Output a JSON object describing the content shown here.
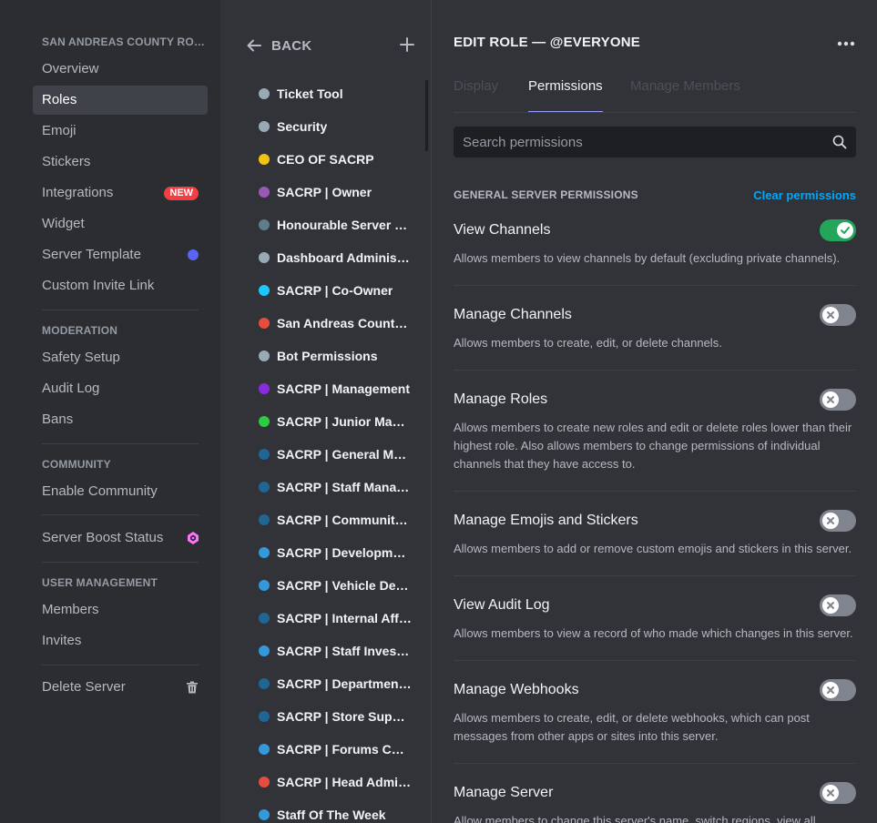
{
  "sidebar": {
    "server_name": "SAN ANDREAS COUNTY ROLEPLAY",
    "items_main": [
      {
        "label": "Overview"
      },
      {
        "label": "Roles"
      },
      {
        "label": "Emoji"
      },
      {
        "label": "Stickers"
      },
      {
        "label": "Integrations",
        "badge": "NEW"
      },
      {
        "label": "Widget"
      },
      {
        "label": "Server Template"
      },
      {
        "label": "Custom Invite Link"
      }
    ],
    "moderation_header": "MODERATION",
    "items_moderation": [
      {
        "label": "Safety Setup"
      },
      {
        "label": "Audit Log"
      },
      {
        "label": "Bans"
      }
    ],
    "community_header": "COMMUNITY",
    "enable_community": "Enable Community",
    "server_boost": "Server Boost Status",
    "user_management_header": "USER MANAGEMENT",
    "items_user_management": [
      {
        "label": "Members"
      },
      {
        "label": "Invites"
      }
    ],
    "delete_server": "Delete Server",
    "colors": {
      "new_badge": "#f23f43",
      "template_dot": "#5865f2",
      "boost": "#ff73fa"
    }
  },
  "roles_panel": {
    "back_label": "BACK",
    "roles": [
      {
        "name": "Ticket Tool",
        "color": "#99aab5"
      },
      {
        "name": "Security",
        "color": "#99aab5"
      },
      {
        "name": "CEO OF SACRP",
        "color": "#f1c40f"
      },
      {
        "name": "SACRP | Owner",
        "color": "#9b59b6"
      },
      {
        "name": "Honourable Server Owner",
        "color": "#607d8b"
      },
      {
        "name": "Dashboard Administrator",
        "color": "#99aab5"
      },
      {
        "name": "SACRP | Co-Owner",
        "color": "#1cc9ff"
      },
      {
        "name": "San Andreas County Roleplay",
        "color": "#e74c3c"
      },
      {
        "name": "Bot Permissions",
        "color": "#99aab5"
      },
      {
        "name": "SACRP | Management",
        "color": "#8a2be2"
      },
      {
        "name": "SACRP | Junior Management",
        "color": "#2ecc40"
      },
      {
        "name": "SACRP | General Manager",
        "color": "#206694"
      },
      {
        "name": "SACRP | Staff Manager",
        "color": "#206694"
      },
      {
        "name": "SACRP | Community Manager",
        "color": "#206694"
      },
      {
        "name": "SACRP | Development",
        "color": "#3498db"
      },
      {
        "name": "SACRP | Vehicle Developer",
        "color": "#3498db"
      },
      {
        "name": "SACRP | Internal Affairs",
        "color": "#206694"
      },
      {
        "name": "SACRP | Staff Investigator",
        "color": "#3498db"
      },
      {
        "name": "SACRP | Department Head",
        "color": "#206694"
      },
      {
        "name": "SACRP | Store Support",
        "color": "#206694"
      },
      {
        "name": "SACRP | Forums Coordinator",
        "color": "#3498db"
      },
      {
        "name": "SACRP | Head Administrator",
        "color": "#e74c3c"
      },
      {
        "name": "Staff Of The Week",
        "color": "#3498db"
      }
    ]
  },
  "main": {
    "title": "EDIT ROLE — @EVERYONE",
    "tabs": [
      {
        "label": "Display"
      },
      {
        "label": "Permissions"
      },
      {
        "label": "Manage Members"
      }
    ],
    "active_tab": "Permissions",
    "search": {
      "placeholder": "Search permissions",
      "value": ""
    },
    "section_header": "GENERAL SERVER PERMISSIONS",
    "clear_label": "Clear permissions",
    "accent": "#949cf7",
    "permissions": [
      {
        "name": "View Channels",
        "desc": "Allows members to view channels by default (excluding private channels).",
        "enabled": true
      },
      {
        "name": "Manage Channels",
        "desc": "Allows members to create, edit, or delete channels.",
        "enabled": false
      },
      {
        "name": "Manage Roles",
        "desc": "Allows members to create new roles and edit or delete roles lower than their highest role. Also allows members to change permissions of individual channels that they have access to.",
        "enabled": false
      },
      {
        "name": "Manage Emojis and Stickers",
        "desc": "Allows members to add or remove custom emojis and stickers in this server.",
        "enabled": false
      },
      {
        "name": "View Audit Log",
        "desc": "Allows members to view a record of who made which changes in this server.",
        "enabled": false
      },
      {
        "name": "Manage Webhooks",
        "desc": "Allows members to create, edit, or delete webhooks, which can post messages from other apps or sites into this server.",
        "enabled": false
      },
      {
        "name": "Manage Server",
        "desc": "Allow members to change this server's name, switch regions, view all",
        "enabled": false
      }
    ]
  }
}
